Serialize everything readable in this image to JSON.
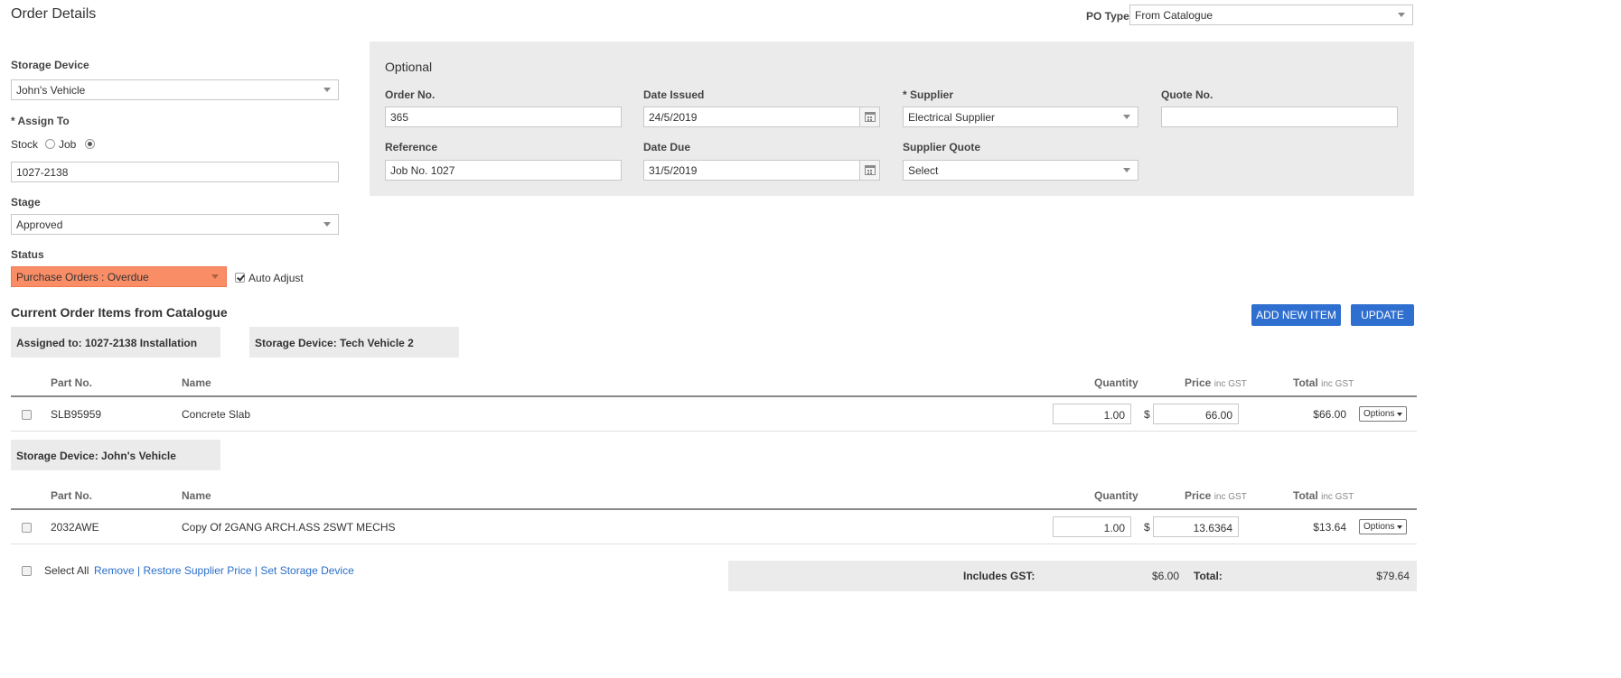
{
  "page_title": "Order Details",
  "po_type": {
    "label": "PO Type",
    "value": "From Catalogue"
  },
  "left": {
    "storage_device": {
      "label": "Storage Device",
      "value": "John's Vehicle"
    },
    "assign_to": {
      "label": "* Assign To",
      "option_stock": "Stock",
      "option_job": "Job",
      "selected": "job",
      "value": "1027-2138"
    },
    "stage": {
      "label": "Stage",
      "value": "Approved"
    },
    "status": {
      "label": "Status",
      "value": "Purchase Orders : Overdue",
      "color": "#f98d66",
      "auto_adjust_label": "Auto Adjust",
      "auto_adjust_checked": true
    }
  },
  "optional": {
    "title": "Optional",
    "order_no": {
      "label": "Order No.",
      "value": "365"
    },
    "date_issued": {
      "label": "Date Issued",
      "value": "24/5/2019"
    },
    "supplier": {
      "label": "* Supplier",
      "value": "Electrical Supplier"
    },
    "quote_no": {
      "label": "Quote No.",
      "value": ""
    },
    "reference": {
      "label": "Reference",
      "value": "Job No. 1027"
    },
    "date_due": {
      "label": "Date Due",
      "value": "31/5/2019"
    },
    "supplier_quote": {
      "label": "Supplier Quote",
      "value": "Select"
    }
  },
  "items_section": {
    "title": "Current Order Items from Catalogue",
    "add_button": "ADD NEW ITEM",
    "update_button": "UPDATE",
    "accent_color": "#2f6fd0"
  },
  "columns": {
    "part_no": "Part No.",
    "name": "Name",
    "quantity": "Quantity",
    "price": "Price",
    "price_sub": "inc GST",
    "total": "Total",
    "total_sub": "inc GST"
  },
  "groups": [
    {
      "tags": [
        "Assigned to: 1027-2138 Installation",
        "Storage Device: Tech Vehicle 2"
      ],
      "rows": [
        {
          "part_no": "SLB95959",
          "name": "Concrete Slab",
          "quantity": "1.00",
          "currency": "$",
          "price": "66.00",
          "total": "$66.00",
          "options": "Options"
        }
      ]
    },
    {
      "tags": [
        "Storage Device: John's Vehicle"
      ],
      "rows": [
        {
          "part_no": "2032AWE",
          "name": "Copy Of 2GANG ARCH.ASS 2SWT MECHS",
          "quantity": "1.00",
          "currency": "$",
          "price": "13.6364",
          "total": "$13.64",
          "options": "Options"
        }
      ]
    }
  ],
  "footer": {
    "select_all": "Select All",
    "remove": "Remove",
    "restore_supplier_price": "Restore Supplier Price",
    "set_storage_device": "Set Storage Device",
    "separator": "|",
    "includes_gst_label": "Includes GST:",
    "includes_gst_value": "$6.00",
    "total_label": "Total:",
    "total_value": "$79.64"
  }
}
